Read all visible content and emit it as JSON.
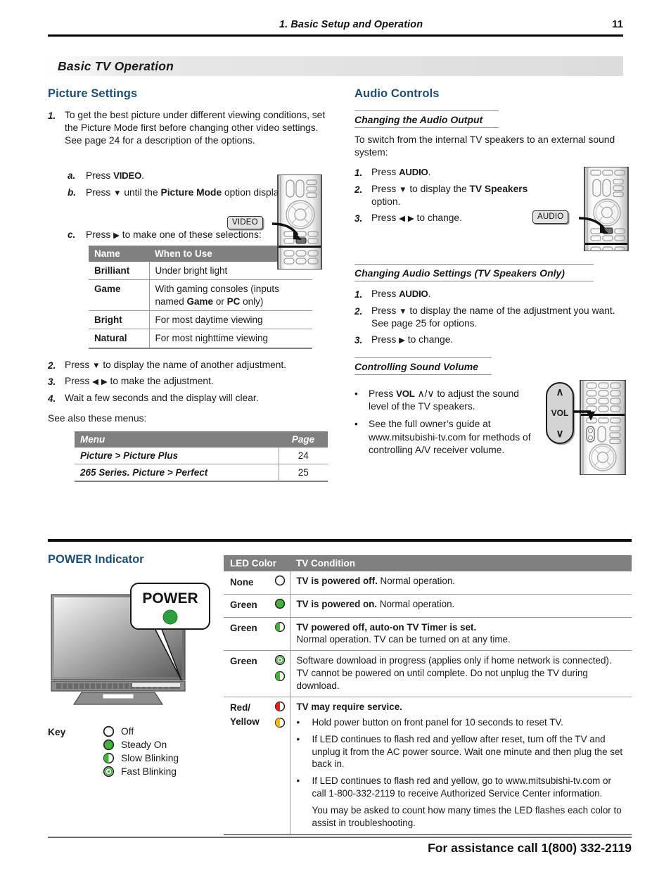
{
  "runhead": {
    "title": "1.  Basic Setup and Operation",
    "page": "11"
  },
  "banner": {
    "title": "Basic TV Operation"
  },
  "picture_settings": {
    "heading": "Picture Settings",
    "step1": {
      "num": "1.",
      "text": "To get the best picture under different viewing conditions, set the Picture Mode first before changing other video settings.  See page 24 for a description of the options."
    },
    "sub_a": {
      "num": "a.",
      "pre": "Press ",
      "key": "VIDEO",
      "post": "."
    },
    "sub_b": {
      "num": "b.",
      "pre": "Press ",
      "arrow": "▼",
      "mid": " until the ",
      "bold": "Picture Mode",
      "post": " option displays."
    },
    "sub_c": {
      "num": "c.",
      "pre": "Press ",
      "arrow": "▶",
      "post": " to make one of these selections:"
    },
    "table": {
      "headers": [
        "Name",
        "When to Use"
      ],
      "rows": [
        {
          "name": "Brilliant",
          "use": "Under bright light"
        },
        {
          "name": "Game",
          "use": "With gaming consoles (inputs named Game or PC only)"
        },
        {
          "name": "Bright",
          "use": "For most daytime viewing"
        },
        {
          "name": "Natural",
          "use": "For most nighttime viewing"
        }
      ]
    },
    "step2": {
      "num": "2.",
      "pre": "Press ",
      "arrow": "▼",
      "post": " to display the name of another adjustment."
    },
    "step3": {
      "num": "3.",
      "pre": "Press ",
      "arrow_l": "◀",
      "arrow_r": "▶",
      "post": " to make the adjustment."
    },
    "step4": {
      "num": "4.",
      "text": "Wait a few seconds and the display will clear."
    },
    "see_also": "See also these menus:",
    "menu_table": {
      "headers": [
        "Menu",
        "Page"
      ],
      "rows": [
        {
          "menu": "Picture > Picture Plus",
          "page": "24"
        },
        {
          "menu": "265 Series.  Picture > Perfect",
          "page": "25"
        }
      ]
    }
  },
  "audio_controls": {
    "heading": "Audio Controls",
    "sub1": {
      "title": "Changing the Audio Output",
      "intro": "To switch from the internal TV speakers to an external sound system:",
      "steps": [
        {
          "num": "1.",
          "pre": "Press ",
          "key": "AUDIO",
          "post": "."
        },
        {
          "num": "2.",
          "pre": "Press ",
          "arrow": "▼",
          "mid": " to display the ",
          "bold": "TV Speakers",
          "post": " option."
        },
        {
          "num": "3.",
          "pre": "Press ",
          "arrow_l": "◀",
          "arrow_r": "▶",
          "post": " to change."
        }
      ]
    },
    "sub2": {
      "title": "Changing Audio Settings (TV Speakers Only)",
      "steps": [
        {
          "num": "1.",
          "pre": "Press ",
          "key": "AUDIO",
          "post": "."
        },
        {
          "num": "2.",
          "pre": "Press ",
          "arrow": "▼",
          "post": " to display the name of the adjustment you want.  See page 25 for options."
        },
        {
          "num": "3.",
          "pre": "Press ",
          "arrow": "▶",
          "post": " to change."
        }
      ]
    },
    "sub3": {
      "title": "Controlling Sound Volume",
      "bullets": [
        {
          "pre": "Press ",
          "key": "VOL",
          "glyphs": "∧/∨",
          "post": " to adjust the sound level of the TV speakers."
        },
        {
          "text": "See the full owner’s guide at www.mitsubishi-tv.com for methods of controlling A/V receiver volume."
        }
      ]
    }
  },
  "remotes": {
    "video_callout": "VIDEO",
    "audio_callout": "AUDIO",
    "vol_callout": "VOL"
  },
  "power_indicator": {
    "heading": "POWER Indicator",
    "tv_callout_label": "POWER",
    "key_label": "Key",
    "key_items": [
      {
        "icon": "led-off",
        "label": "Off"
      },
      {
        "icon": "led-steady",
        "label": "Steady On"
      },
      {
        "icon": "led-slow",
        "label": "Slow Blinking"
      },
      {
        "icon": "led-fast",
        "label": "Fast Blinking"
      }
    ],
    "table": {
      "headers": [
        "LED Color",
        "TV Condition"
      ],
      "rows": [
        {
          "color_names": [
            "None"
          ],
          "icons": [
            "led-off"
          ],
          "bold": "TV is powered off.",
          "rest": "  Normal operation."
        },
        {
          "color_names": [
            "Green"
          ],
          "icons": [
            "led-steady"
          ],
          "bold": "TV is powered on.",
          "rest": "  Normal operation."
        },
        {
          "color_names": [
            "Green"
          ],
          "icons": [
            "led-slow"
          ],
          "bold": "TV powered off, auto-on TV Timer is set.",
          "rest": "Normal operation.  TV can be turned on at any time."
        },
        {
          "color_names": [
            "Green"
          ],
          "icons": [
            "led-fast",
            "led-slow"
          ],
          "bold": "",
          "rest": "Software download in progress (applies only if home network is connected).  TV cannot be powered on until complete.  Do not unplug the TV during download."
        },
        {
          "color_names": [
            "Red/",
            "Yellow"
          ],
          "icons": [
            "led-red-half",
            "led-yellow-half"
          ],
          "bold": "TV may require service.",
          "bullets": [
            "Hold power button on front panel for 10 seconds to reset TV.",
            "If LED continues to flash red and yellow after reset, turn off the TV and unplug it from the AC power source.  Wait one minute and then plug the set back in.",
            "If LED continues to flash red and yellow, go to www.mitsubishi-tv.com or call 1-800-332-2119 to receive Authorized Service Center information."
          ],
          "note": "You may be asked to count how many times the LED flashes each color to assist in troubleshooting."
        }
      ]
    }
  },
  "footer": {
    "text": "For assistance call 1(800) 332-2119"
  },
  "colors": {
    "heading_blue": "#1f4e72",
    "table_header_gray": "#808080",
    "led_green": "#3db03d",
    "led_red": "#e02020",
    "led_yellow": "#f0c000"
  }
}
